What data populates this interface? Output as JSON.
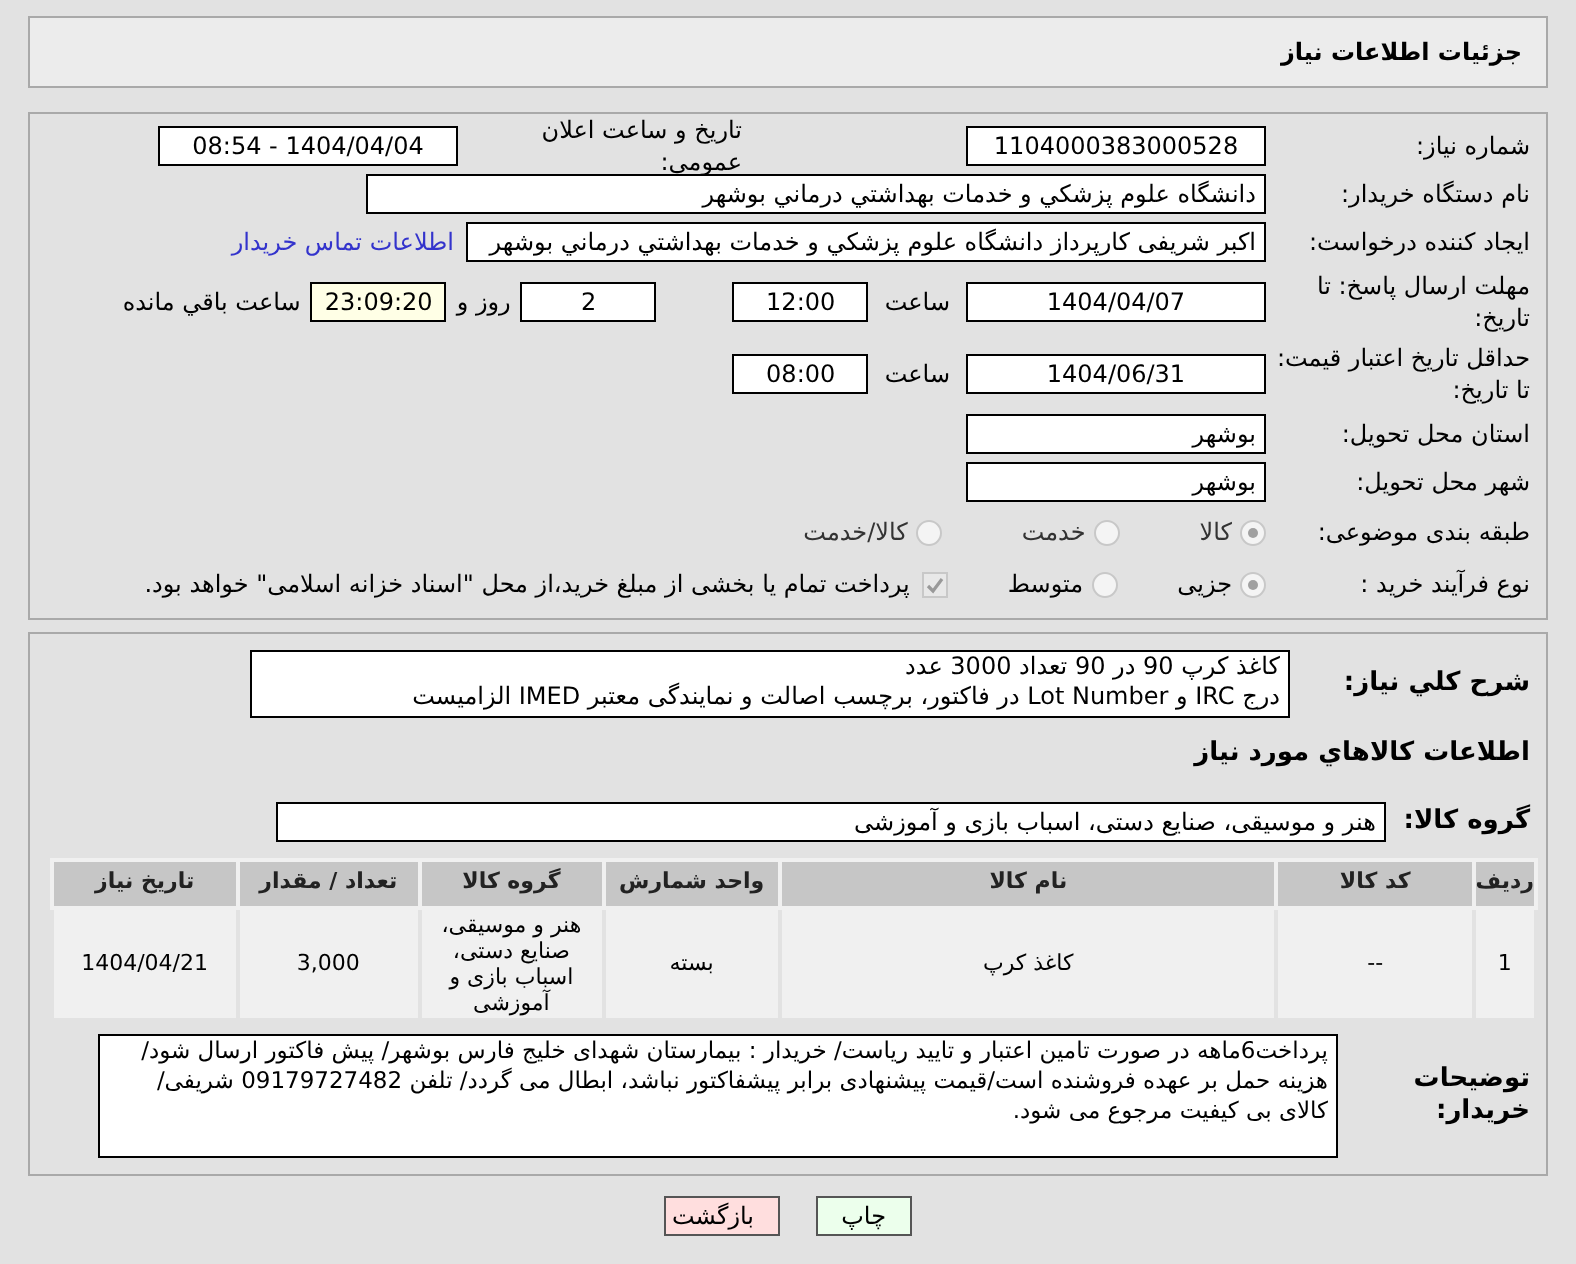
{
  "header": {
    "title": "جزئیات اطلاعات نیاز"
  },
  "need_number": {
    "label": "شماره نیاز:",
    "value": "1104000383000528"
  },
  "announce": {
    "label": "تاریخ و ساعت اعلان عمومي:",
    "value": "1404/04/04 - 08:54"
  },
  "buyer_org": {
    "label": "نام دستگاه خریدار:",
    "value": "دانشگاه علوم پزشکي و خدمات بهداشتي درماني بوشهر"
  },
  "creator": {
    "label": "ایجاد کننده درخواست:",
    "value": "اکبر شریفی کارپرداز دانشگاه علوم پزشکي و خدمات بهداشتي درماني بوشهر",
    "link": "اطلاعات تماس خریدار"
  },
  "deadline": {
    "label": "مهلت ارسال پاسخ: تا تاریخ:",
    "date": "1404/04/07",
    "time_label": "ساعت",
    "time": "12:00",
    "days": "2",
    "days_suffix": "روز و",
    "remaining": "23:09:20",
    "remaining_suffix": "ساعت باقي مانده"
  },
  "validity": {
    "label": "حداقل تاریخ اعتبار قیمت: تا تاریخ:",
    "date": "1404/06/31",
    "time_label": "ساعت",
    "time": "08:00"
  },
  "province": {
    "label": "استان محل تحویل:",
    "value": "بوشهر"
  },
  "city": {
    "label": "شهر محل تحویل:",
    "value": "بوشهر"
  },
  "category": {
    "label": "طبقه بندی موضوعی:",
    "options": [
      {
        "label": "کالا",
        "selected": true
      },
      {
        "label": "خدمت",
        "selected": false
      },
      {
        "label": "کالا/خدمت",
        "selected": false
      }
    ]
  },
  "process": {
    "label": "نوع فرآیند خرید :",
    "options": [
      {
        "label": "جزیی",
        "selected": true
      },
      {
        "label": "متوسط",
        "selected": false
      }
    ],
    "treasury": {
      "checked": true,
      "text": "پرداخت تمام یا بخشی از مبلغ خرید،از محل \"اسناد خزانه اسلامی\" خواهد بود."
    }
  },
  "description": {
    "label": "شرح كلي نياز:",
    "lines": [
      "كاغذ كرپ 90 در 90 تعداد 3000 عدد",
      "درج IRC و Lot Number در فاکتور، برچسب اصالت و نمایندگی معتبر IMED الزامیست"
    ]
  },
  "goods_title": "اطلاعات كالاهاي مورد نياز",
  "goods_group": {
    "label": "گروه کالا:",
    "value": "هنر و موسیقی، صنایع دستی، اسباب بازی و آموزشی"
  },
  "table": {
    "columns": [
      "ردیف",
      "کد کالا",
      "نام کالا",
      "واحد شمارش",
      "گروه کالا",
      "تعداد / مقدار",
      "تاریخ نیاز"
    ],
    "rows": [
      [
        "1",
        "--",
        "کاغذ کرپ",
        "بسته",
        "هنر و موسیقی، صنایع دستی، اسباب بازی و آموزشی",
        "3,000",
        "1404/04/21"
      ]
    ]
  },
  "notes": {
    "label": "توضیحات خریدار:",
    "text": "پرداخت6ماهه در صورت تامین اعتبار و تایید ریاست/ خریدار : بیمارستان شهدای خلیج فارس بوشهر/ پیش فاکتور ارسال شود/ هزینه حمل بر عهده فروشنده است/قیمت پیشنهادی برابر پیشفاکتور نباشد، ابطال می گردد/ تلفن 09179727482 شریفی/ کالای بی کیفیت مرجوع می شود."
  },
  "buttons": [
    {
      "kind": "print",
      "label": "چاپ"
    },
    {
      "kind": "back",
      "label": "بازگشت"
    }
  ]
}
